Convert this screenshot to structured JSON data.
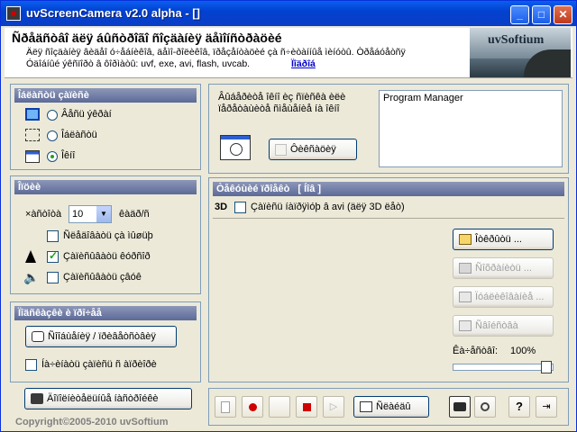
{
  "window": {
    "title": "uvScreenCamera v2.0 alpha - []",
    "minimize_glyph": "_",
    "maximize_glyph": "□",
    "close_glyph": "✕"
  },
  "header": {
    "title": "Ñðåäñòâî äëÿ áûñòðîãî ñîçäàíèÿ äåìîíñòðàöèé",
    "description": "Äëÿ ñîçäàíèÿ âèäåî ó÷åáíèêîâ, äåìî-ðîëèêîâ, ïðåçåíòàöèé çà ñ÷èòàííûå ìèíóòû. Òðåáóåòñÿ",
    "formats": "Óäîáíûé ýêñïîðò â ôîðìàòû: uvf, exe, avi, flash, uvcab.",
    "link": "Ïîäðîá",
    "logo_text": "uvSoftium"
  },
  "capture_area": {
    "heading": "Îáëàñòü çàïèñè",
    "options": [
      {
        "label": "Âåñü ýêðàí",
        "selected": false,
        "icon": "monitor-icon"
      },
      {
        "label": "Îáëàñòü",
        "selected": false,
        "icon": "region-icon"
      },
      {
        "label": "Îêíî",
        "selected": true,
        "icon": "window-icon"
      }
    ]
  },
  "window_select": {
    "hint": "Âûáåðèòå îêíî èç ñïèñêà èëè ïåðåòàùèòå ñìåùåíèå íà îêíî",
    "fixed_label": "Ôèêñàöèÿ",
    "fixed_checked": false,
    "windows": [
      "Program Manager"
    ]
  },
  "settings": {
    "heading": "Îïöèè",
    "fps_label": "×àñòîòà",
    "fps_value": "10",
    "fps_unit": "êàäð/ñ",
    "options": [
      {
        "label": "Ñëåäîâàòü çà ìûøüþ",
        "checked": false
      },
      {
        "label": "Çàïèñûâàòü êóðñîð",
        "checked": true
      },
      {
        "label": "Çàïèñûâàòü çâóê",
        "checked": false
      }
    ]
  },
  "misc": {
    "heading": "Ïîäñêàçêè è ïðî÷åå",
    "annotations_button": "Ñîîáùåíèÿ / ïðèâåòñòâèÿ",
    "minimize_checkbox_label": "Íà÷èíàòü çàïèñü ñ àïðèîðè",
    "minimize_checked": false,
    "settings_button": "Äîïîëíèòåëüíûå íàñòðîéêè"
  },
  "current_project": {
    "heading": "Òåêóùèé ïðîåêò",
    "heading_suffix": "[ Íîâ ]",
    "mode_3d": "3D",
    "avi_checkbox_label": "Çàïèñü íàïðÿìóþ â avi (äëÿ 3D ëåò)",
    "avi_checked": false,
    "open_button": "Îòêðûòü ...",
    "save_button": "Ñîõðàíèòü ...",
    "export_button": "Ïóáëèêîâàíèå ...",
    "properties_button": "Ñâîéñòâà",
    "quality_label": "Êà÷åñòâî:",
    "quality_value": "100%",
    "quality_fraction": 1.0
  },
  "toolbar": {
    "settings_label": "Ñëàéäû",
    "help_glyph": "?",
    "exit_glyph": "⇥"
  },
  "footer": {
    "copyright": "Copyright©2005-2010 uvSoftium"
  }
}
